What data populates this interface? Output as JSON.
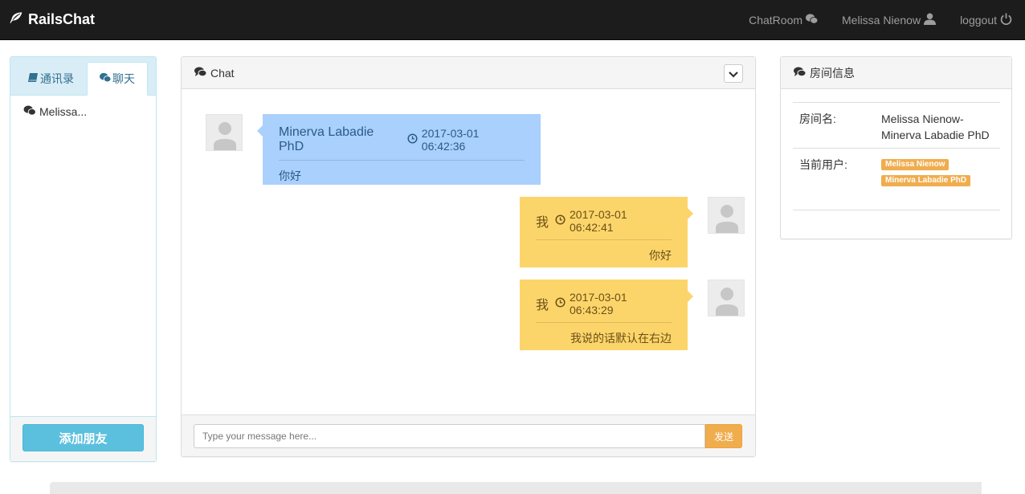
{
  "navbar": {
    "brand": "RailsChat",
    "chatroom": "ChatRoom",
    "user": "Melissa Nienow",
    "logout": "loggout"
  },
  "sidebar": {
    "tabs": [
      {
        "label": "通讯录",
        "icon": "book-icon"
      },
      {
        "label": "聊天",
        "icon": "wechat-icon"
      }
    ],
    "rooms": [
      {
        "name": "Melissa..."
      }
    ],
    "add_friend": "添加朋友"
  },
  "chat": {
    "title": "Chat",
    "messages": [
      {
        "sender": "Minerva Labadie PhD",
        "time": "2017-03-01 06:42:36",
        "text": "你好",
        "side": "left"
      },
      {
        "sender": "我",
        "time": "2017-03-01 06:42:41",
        "text": "你好",
        "side": "right"
      },
      {
        "sender": "我",
        "time": "2017-03-01 06:43:29",
        "text": "我说的话默认在右边",
        "side": "right"
      }
    ],
    "input_placeholder": "Type your message here...",
    "send": "发送"
  },
  "room_info": {
    "title": "房间信息",
    "name_key": "房间名:",
    "name_value": "Melissa Nienow-Minerva Labadie PhD",
    "users_key": "当前用户:",
    "users": [
      "Melissa Nienow",
      "Minerva Labadie PhD"
    ]
  },
  "colors": {
    "navbar": "#1c1c1c",
    "bubble_left": "#aad0fd",
    "bubble_right": "#fcd56a",
    "badge": "#f0ad4e",
    "button_info": "#5bc0de"
  }
}
